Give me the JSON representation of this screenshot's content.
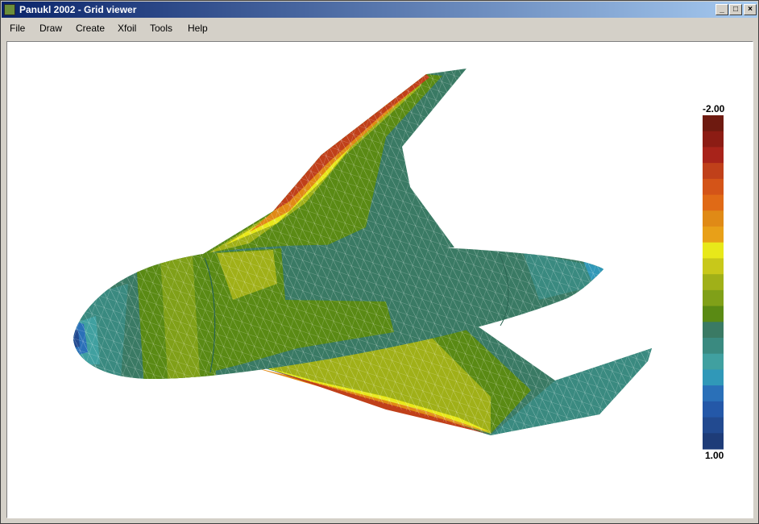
{
  "window": {
    "title": "Panukl 2002 - Grid viewer",
    "controls": {
      "minimize": "_",
      "maximize": "□",
      "close": "×"
    }
  },
  "menu": {
    "items": [
      "File",
      "Draw",
      "Create",
      "Xfoil",
      "Tools",
      "Help"
    ]
  },
  "legend": {
    "top_label": "-2.00",
    "bottom_label": "1.00",
    "colors": [
      "#6e1a10",
      "#8c1c14",
      "#a8231a",
      "#c0401a",
      "#d45418",
      "#e06a16",
      "#e08a16",
      "#e8a018",
      "#e8e81a",
      "#c8c81a",
      "#a0b018",
      "#80a018",
      "#5a8a14",
      "#3a7a64",
      "#3a8a80",
      "#40a0a0",
      "#3098b8",
      "#2a70b8",
      "#2458a8",
      "#224a90",
      "#1e3c78"
    ]
  },
  "colors": {
    "titlebar_start": "#0a246a",
    "titlebar_end": "#a6caf0",
    "window_bg": "#d4d0c8"
  }
}
